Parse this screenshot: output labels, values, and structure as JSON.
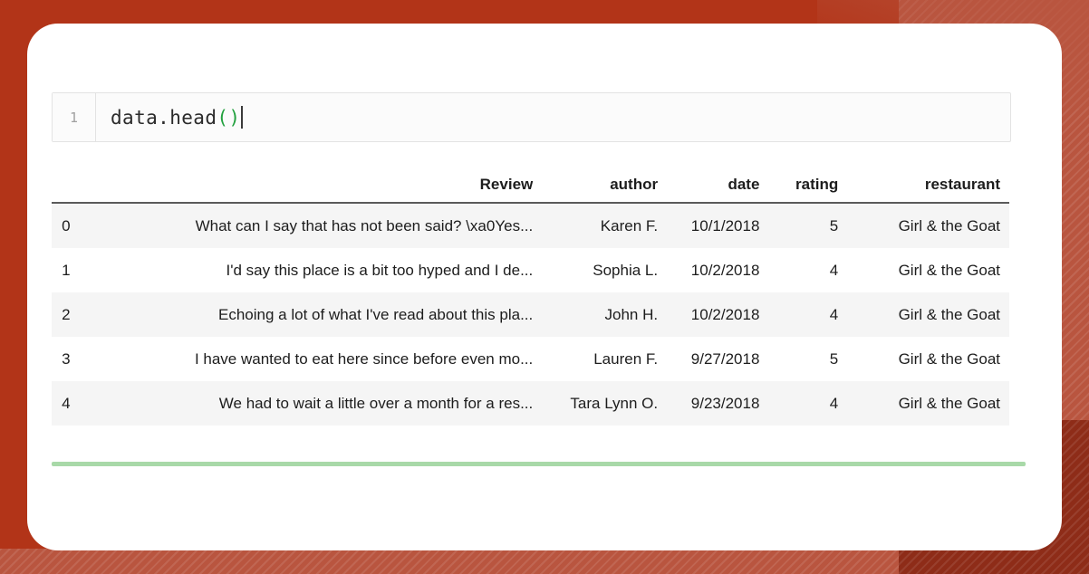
{
  "theme": {
    "background_color": "#b23418",
    "accent_stripe_color": "#b9553f",
    "card_color": "#ffffff",
    "green_rule_color": "#a8d9a8",
    "header_underline_color": "#5a5a5a",
    "stripe_row_color": "#f5f5f5"
  },
  "code_cell": {
    "line_number": "1",
    "code_text": "data.head",
    "code_parens": "()",
    "caret_visible": true
  },
  "dataframe": {
    "columns": [
      "",
      "Review",
      "author",
      "date",
      "rating",
      "restaurant"
    ],
    "rows": [
      {
        "index": "0",
        "review": "What can I say that has not been said? \\xa0Yes...",
        "author": "Karen F.",
        "date": "10/1/2018",
        "rating": "5",
        "restaurant": "Girl & the Goat"
      },
      {
        "index": "1",
        "review": "I'd say this place is a bit too hyped and I de...",
        "author": "Sophia L.",
        "date": "10/2/2018",
        "rating": "4",
        "restaurant": "Girl & the Goat"
      },
      {
        "index": "2",
        "review": "Echoing a lot of what I've read about this pla...",
        "author": "John H.",
        "date": "10/2/2018",
        "rating": "4",
        "restaurant": "Girl & the Goat"
      },
      {
        "index": "3",
        "review": "I have wanted to eat here since before even mo...",
        "author": "Lauren F.",
        "date": "9/27/2018",
        "rating": "5",
        "restaurant": "Girl & the Goat"
      },
      {
        "index": "4",
        "review": "We had to wait a little over a month for a res...",
        "author": "Tara Lynn O.",
        "date": "9/23/2018",
        "rating": "4",
        "restaurant": "Girl & the Goat"
      }
    ]
  }
}
